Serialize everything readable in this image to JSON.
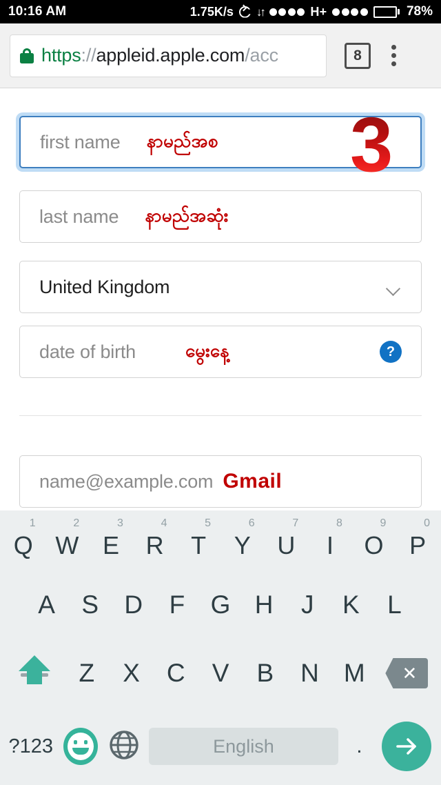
{
  "status_bar": {
    "clock": "10:16 AM",
    "network_speed": "1.75K/s",
    "sync_icon": "sync-icon",
    "data_transfer_icon": "data-transfer-arrows-icon",
    "signal_dots_1": 4,
    "network_type": "H+",
    "signal_dots_2": 4,
    "battery_icon": "battery-icon",
    "battery_percent": "78%",
    "battery_level": 70
  },
  "browser": {
    "lock_icon": "lock-icon",
    "url_scheme": "https",
    "url_separator": "://",
    "url_host": "appleid.apple.com",
    "url_path": "/acc",
    "tab_count": "8",
    "menu_icon": "overflow-menu-icon"
  },
  "form": {
    "first_name": {
      "placeholder": "first name",
      "annotation": "နာမည်အစ",
      "focused": true
    },
    "last_name": {
      "placeholder": "last name",
      "annotation": "နာမည်အဆုံး"
    },
    "country": {
      "value": "United Kingdom",
      "chevron_icon": "chevron-down-icon"
    },
    "date_of_birth": {
      "placeholder": "date of birth",
      "annotation": "မွေးနေ့",
      "help_icon": "help-question-icon",
      "help_label": "?"
    },
    "email": {
      "placeholder": "name@example.com",
      "annotation": "Gmail"
    },
    "step_badge": "3"
  },
  "keyboard": {
    "row1": [
      {
        "key": "Q",
        "sup": "1"
      },
      {
        "key": "W",
        "sup": "2"
      },
      {
        "key": "E",
        "sup": "3"
      },
      {
        "key": "R",
        "sup": "4"
      },
      {
        "key": "T",
        "sup": "5"
      },
      {
        "key": "Y",
        "sup": "6"
      },
      {
        "key": "U",
        "sup": "7"
      },
      {
        "key": "I",
        "sup": "8"
      },
      {
        "key": "O",
        "sup": "9"
      },
      {
        "key": "P",
        "sup": "0"
      }
    ],
    "row2": [
      "A",
      "S",
      "D",
      "F",
      "G",
      "H",
      "J",
      "K",
      "L"
    ],
    "row3": [
      "Z",
      "X",
      "C",
      "V",
      "B",
      "N",
      "M"
    ],
    "shift_icon": "shift-arrow-icon",
    "backspace_icon": "backspace-icon",
    "backspace_label": "✕",
    "numeric_label": "?123",
    "emoji_icon": "emoji-face-icon",
    "globe_icon": "globe-language-icon",
    "space_label": "English",
    "period_label": ".",
    "enter_icon": "enter-arrow-icon"
  },
  "colors": {
    "accent_teal": "#3bb29c",
    "annotation_red": "#c00000",
    "focus_blue": "#3d7ebf",
    "help_blue": "#1172c4",
    "lock_green": "#0b8043",
    "keyboard_bg": "#eceff0"
  }
}
